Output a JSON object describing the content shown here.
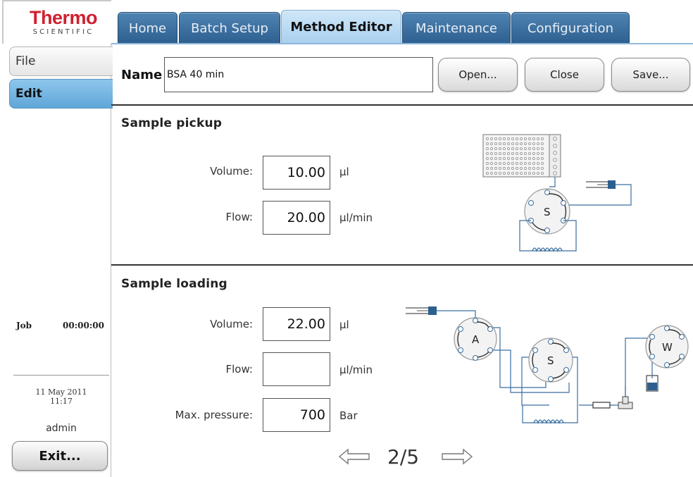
{
  "logo": {
    "main": "Thermo",
    "sub": "SCIENTIFIC"
  },
  "tabs": [
    {
      "label": "Home"
    },
    {
      "label": "Batch Setup"
    },
    {
      "label": "Method Editor"
    },
    {
      "label": "Maintenance"
    },
    {
      "label": "Configuration"
    }
  ],
  "active_tab": "Method Editor",
  "sidebar": {
    "items": [
      {
        "label": "File"
      },
      {
        "label": "Edit"
      }
    ],
    "job_label": "Job",
    "job_time": "00:00:00",
    "date": "11 May 2011",
    "time": "11:17",
    "user": "admin",
    "exit_label": "Exit..."
  },
  "method": {
    "name_label": "Name",
    "name_value": "BSA 40 min",
    "open_label": "Open...",
    "close_label": "Close",
    "save_label": "Save..."
  },
  "sample_pickup": {
    "title": "Sample pickup",
    "volume_label": "Volume:",
    "volume_value": "10.00",
    "volume_unit": "µl",
    "flow_label": "Flow:",
    "flow_value": "20.00",
    "flow_unit": "µl/min",
    "valve_label": "S"
  },
  "sample_loading": {
    "title": "Sample loading",
    "volume_label": "Volume:",
    "volume_value": "22.00",
    "volume_unit": "µl",
    "flow_label": "Flow:",
    "flow_value": "",
    "flow_unit": "µl/min",
    "pressure_label": "Max. pressure:",
    "pressure_value": "700",
    "pressure_unit": "Bar",
    "valve_labels": {
      "a": "A",
      "s": "S",
      "w": "W"
    }
  },
  "pager": {
    "text": "2/5"
  },
  "colors": {
    "tab_blue": "#2d5f8f",
    "active_tab": "#a8d0ef",
    "brand_red": "#d1202f",
    "line_blue": "#3a6fa0"
  }
}
